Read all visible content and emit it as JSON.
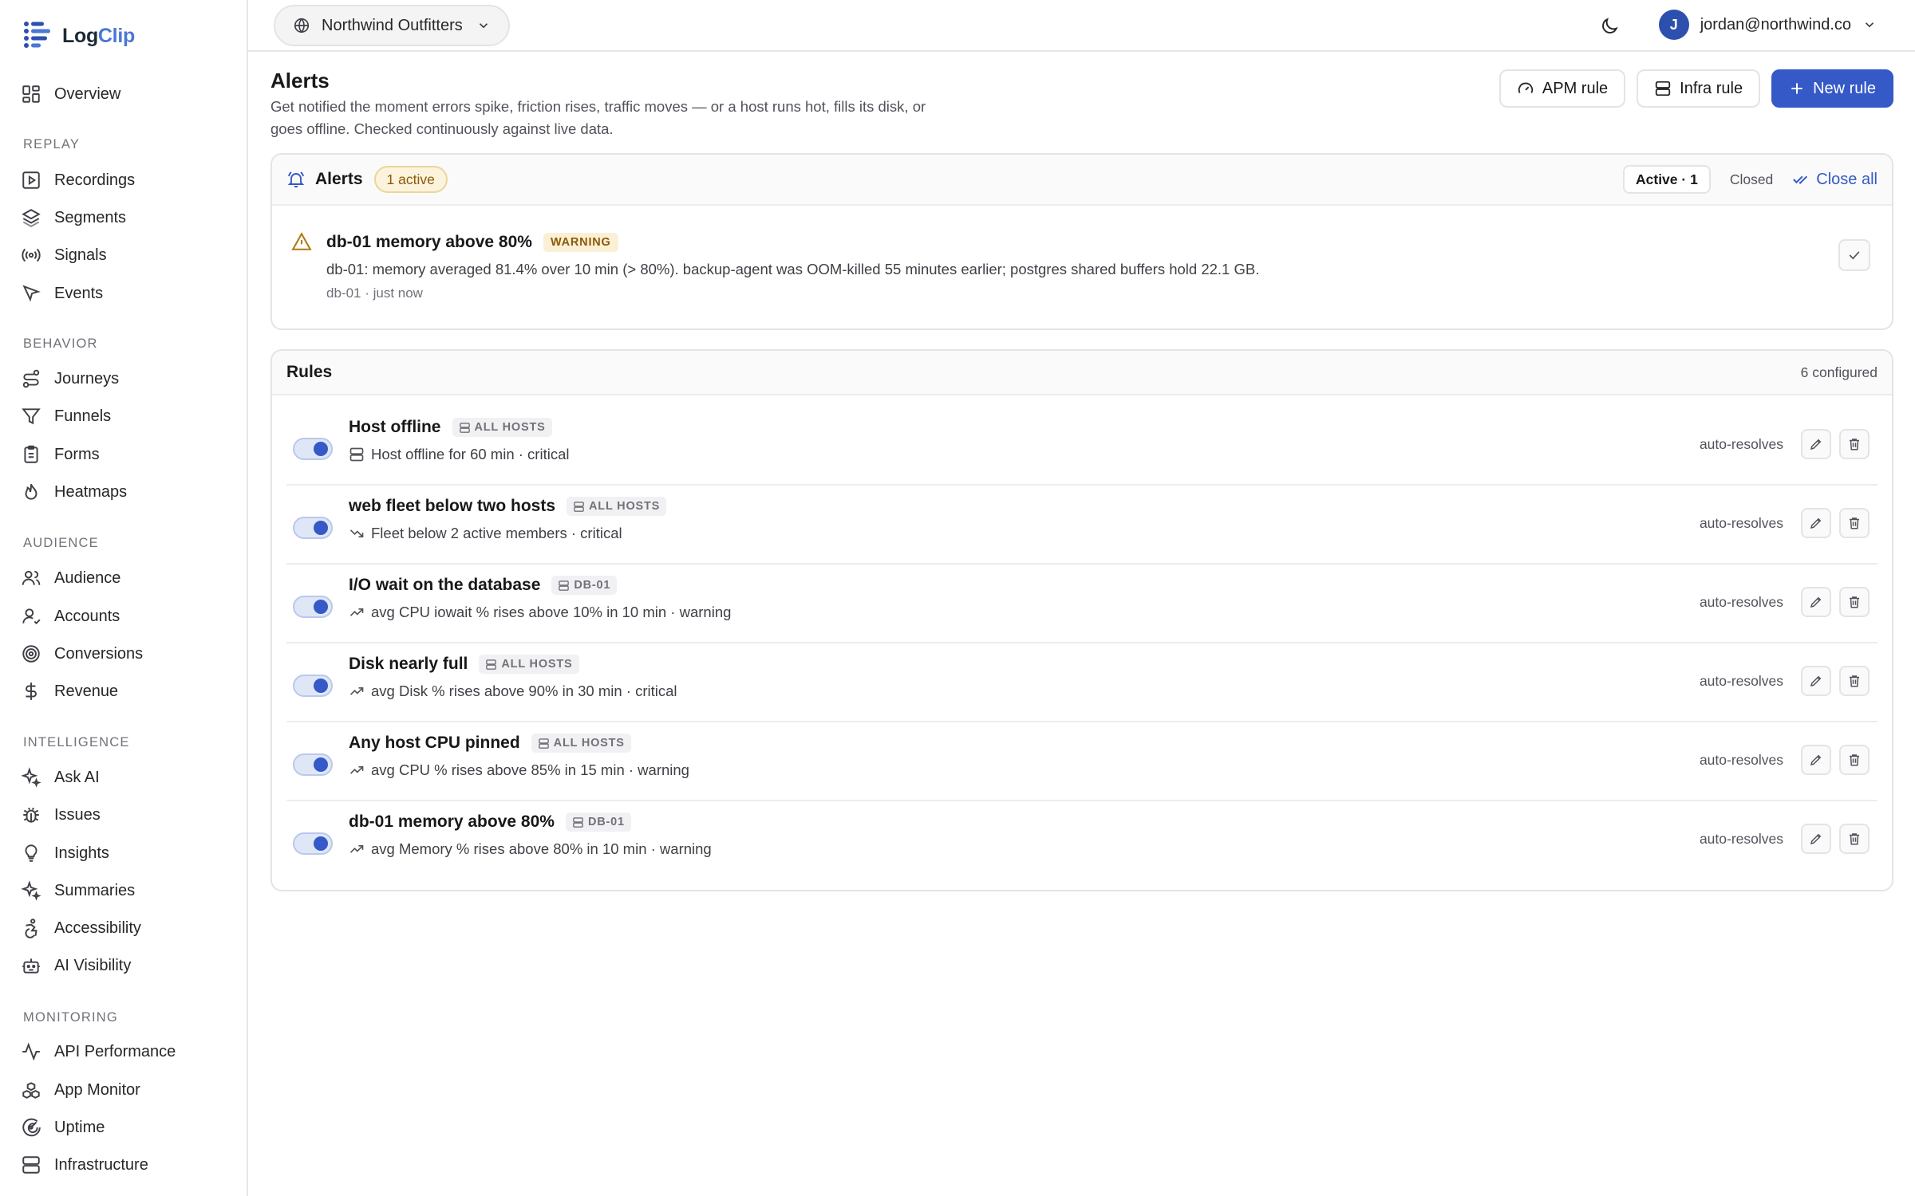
{
  "brand": {
    "name_part1": "Log",
    "name_part2": "Clip"
  },
  "sidebar": {
    "overview": {
      "label": "Overview",
      "icon": "grid-icon"
    },
    "sections": [
      {
        "title": "REPLAY",
        "items": [
          {
            "label": "Recordings",
            "icon": "play-square-icon"
          },
          {
            "label": "Segments",
            "icon": "layers-icon"
          },
          {
            "label": "Signals",
            "icon": "radio-icon"
          },
          {
            "label": "Events",
            "icon": "cursor-icon"
          }
        ]
      },
      {
        "title": "BEHAVIOR",
        "items": [
          {
            "label": "Journeys",
            "icon": "route-icon"
          },
          {
            "label": "Funnels",
            "icon": "funnel-icon"
          },
          {
            "label": "Forms",
            "icon": "clipboard-icon"
          },
          {
            "label": "Heatmaps",
            "icon": "flame-icon"
          }
        ]
      },
      {
        "title": "AUDIENCE",
        "items": [
          {
            "label": "Audience",
            "icon": "users-icon"
          },
          {
            "label": "Accounts",
            "icon": "user-check-icon"
          },
          {
            "label": "Conversions",
            "icon": "target-icon"
          },
          {
            "label": "Revenue",
            "icon": "dollar-icon"
          }
        ]
      },
      {
        "title": "INTELLIGENCE",
        "items": [
          {
            "label": "Ask AI",
            "icon": "sparkles-icon"
          },
          {
            "label": "Issues",
            "icon": "bug-icon"
          },
          {
            "label": "Insights",
            "icon": "lightbulb-icon"
          },
          {
            "label": "Summaries",
            "icon": "sparkles-icon"
          },
          {
            "label": "Accessibility",
            "icon": "accessibility-icon"
          },
          {
            "label": "AI Visibility",
            "icon": "bot-icon"
          }
        ]
      },
      {
        "title": "MONITORING",
        "items": [
          {
            "label": "API Performance",
            "icon": "activity-icon"
          },
          {
            "label": "App Monitor",
            "icon": "boxes-icon"
          },
          {
            "label": "Uptime",
            "icon": "radar-icon"
          },
          {
            "label": "Infrastructure",
            "icon": "server-icon"
          }
        ]
      }
    ]
  },
  "header": {
    "org": "Northwind Outfitters",
    "user_initial": "J",
    "user_email": "jordan@northwind.co"
  },
  "page": {
    "title": "Alerts",
    "description": "Get notified the moment errors spike, friction rises, traffic moves — or a host runs hot, fills its disk, or goes offline. Checked continuously against live data.",
    "actions": {
      "apm": "APM rule",
      "infra": "Infra rule",
      "new": "New rule"
    }
  },
  "alerts_card": {
    "title": "Alerts",
    "badge": "1 active",
    "filter_active": "Active · 1",
    "filter_closed": "Closed",
    "close_all": "Close all",
    "items": [
      {
        "title": "db-01 memory above 80%",
        "severity": "WARNING",
        "description": "db-01: memory averaged 81.4% over 10 min (> 80%). backup-agent was OOM-killed 55 minutes earlier; postgres shared buffers hold 22.1 GB.",
        "meta": "db-01 · just now"
      }
    ]
  },
  "rules_card": {
    "title": "Rules",
    "count": "6 configured",
    "auto_label": "auto-resolves",
    "rules": [
      {
        "name": "Host offline",
        "scope": "ALL HOSTS",
        "desc_icon": "server-icon",
        "description": "Host offline for 60 min · critical",
        "enabled": true
      },
      {
        "name": "web fleet below two hosts",
        "scope": "ALL HOSTS",
        "desc_icon": "trending-down-icon",
        "description": "Fleet below 2 active members · critical",
        "enabled": true
      },
      {
        "name": "I/O wait on the database",
        "scope": "DB-01",
        "desc_icon": "trending-up-icon",
        "description": "avg CPU iowait % rises above 10% in 10 min · warning",
        "enabled": true
      },
      {
        "name": "Disk nearly full",
        "scope": "ALL HOSTS",
        "desc_icon": "trending-up-icon",
        "description": "avg Disk % rises above 90% in 30 min · critical",
        "enabled": true
      },
      {
        "name": "Any host CPU pinned",
        "scope": "ALL HOSTS",
        "desc_icon": "trending-up-icon",
        "description": "avg CPU % rises above 85% in 15 min · warning",
        "enabled": true
      },
      {
        "name": "db-01 memory above 80%",
        "scope": "DB-01",
        "desc_icon": "trending-up-icon",
        "description": "avg Memory % rises above 80% in 10 min · warning",
        "enabled": true
      }
    ]
  },
  "colors": {
    "accent": "#3559c7",
    "brand_blue": "#4a78d6",
    "warning_bg": "#fcf3dc",
    "warning_text": "#8a5a06"
  }
}
